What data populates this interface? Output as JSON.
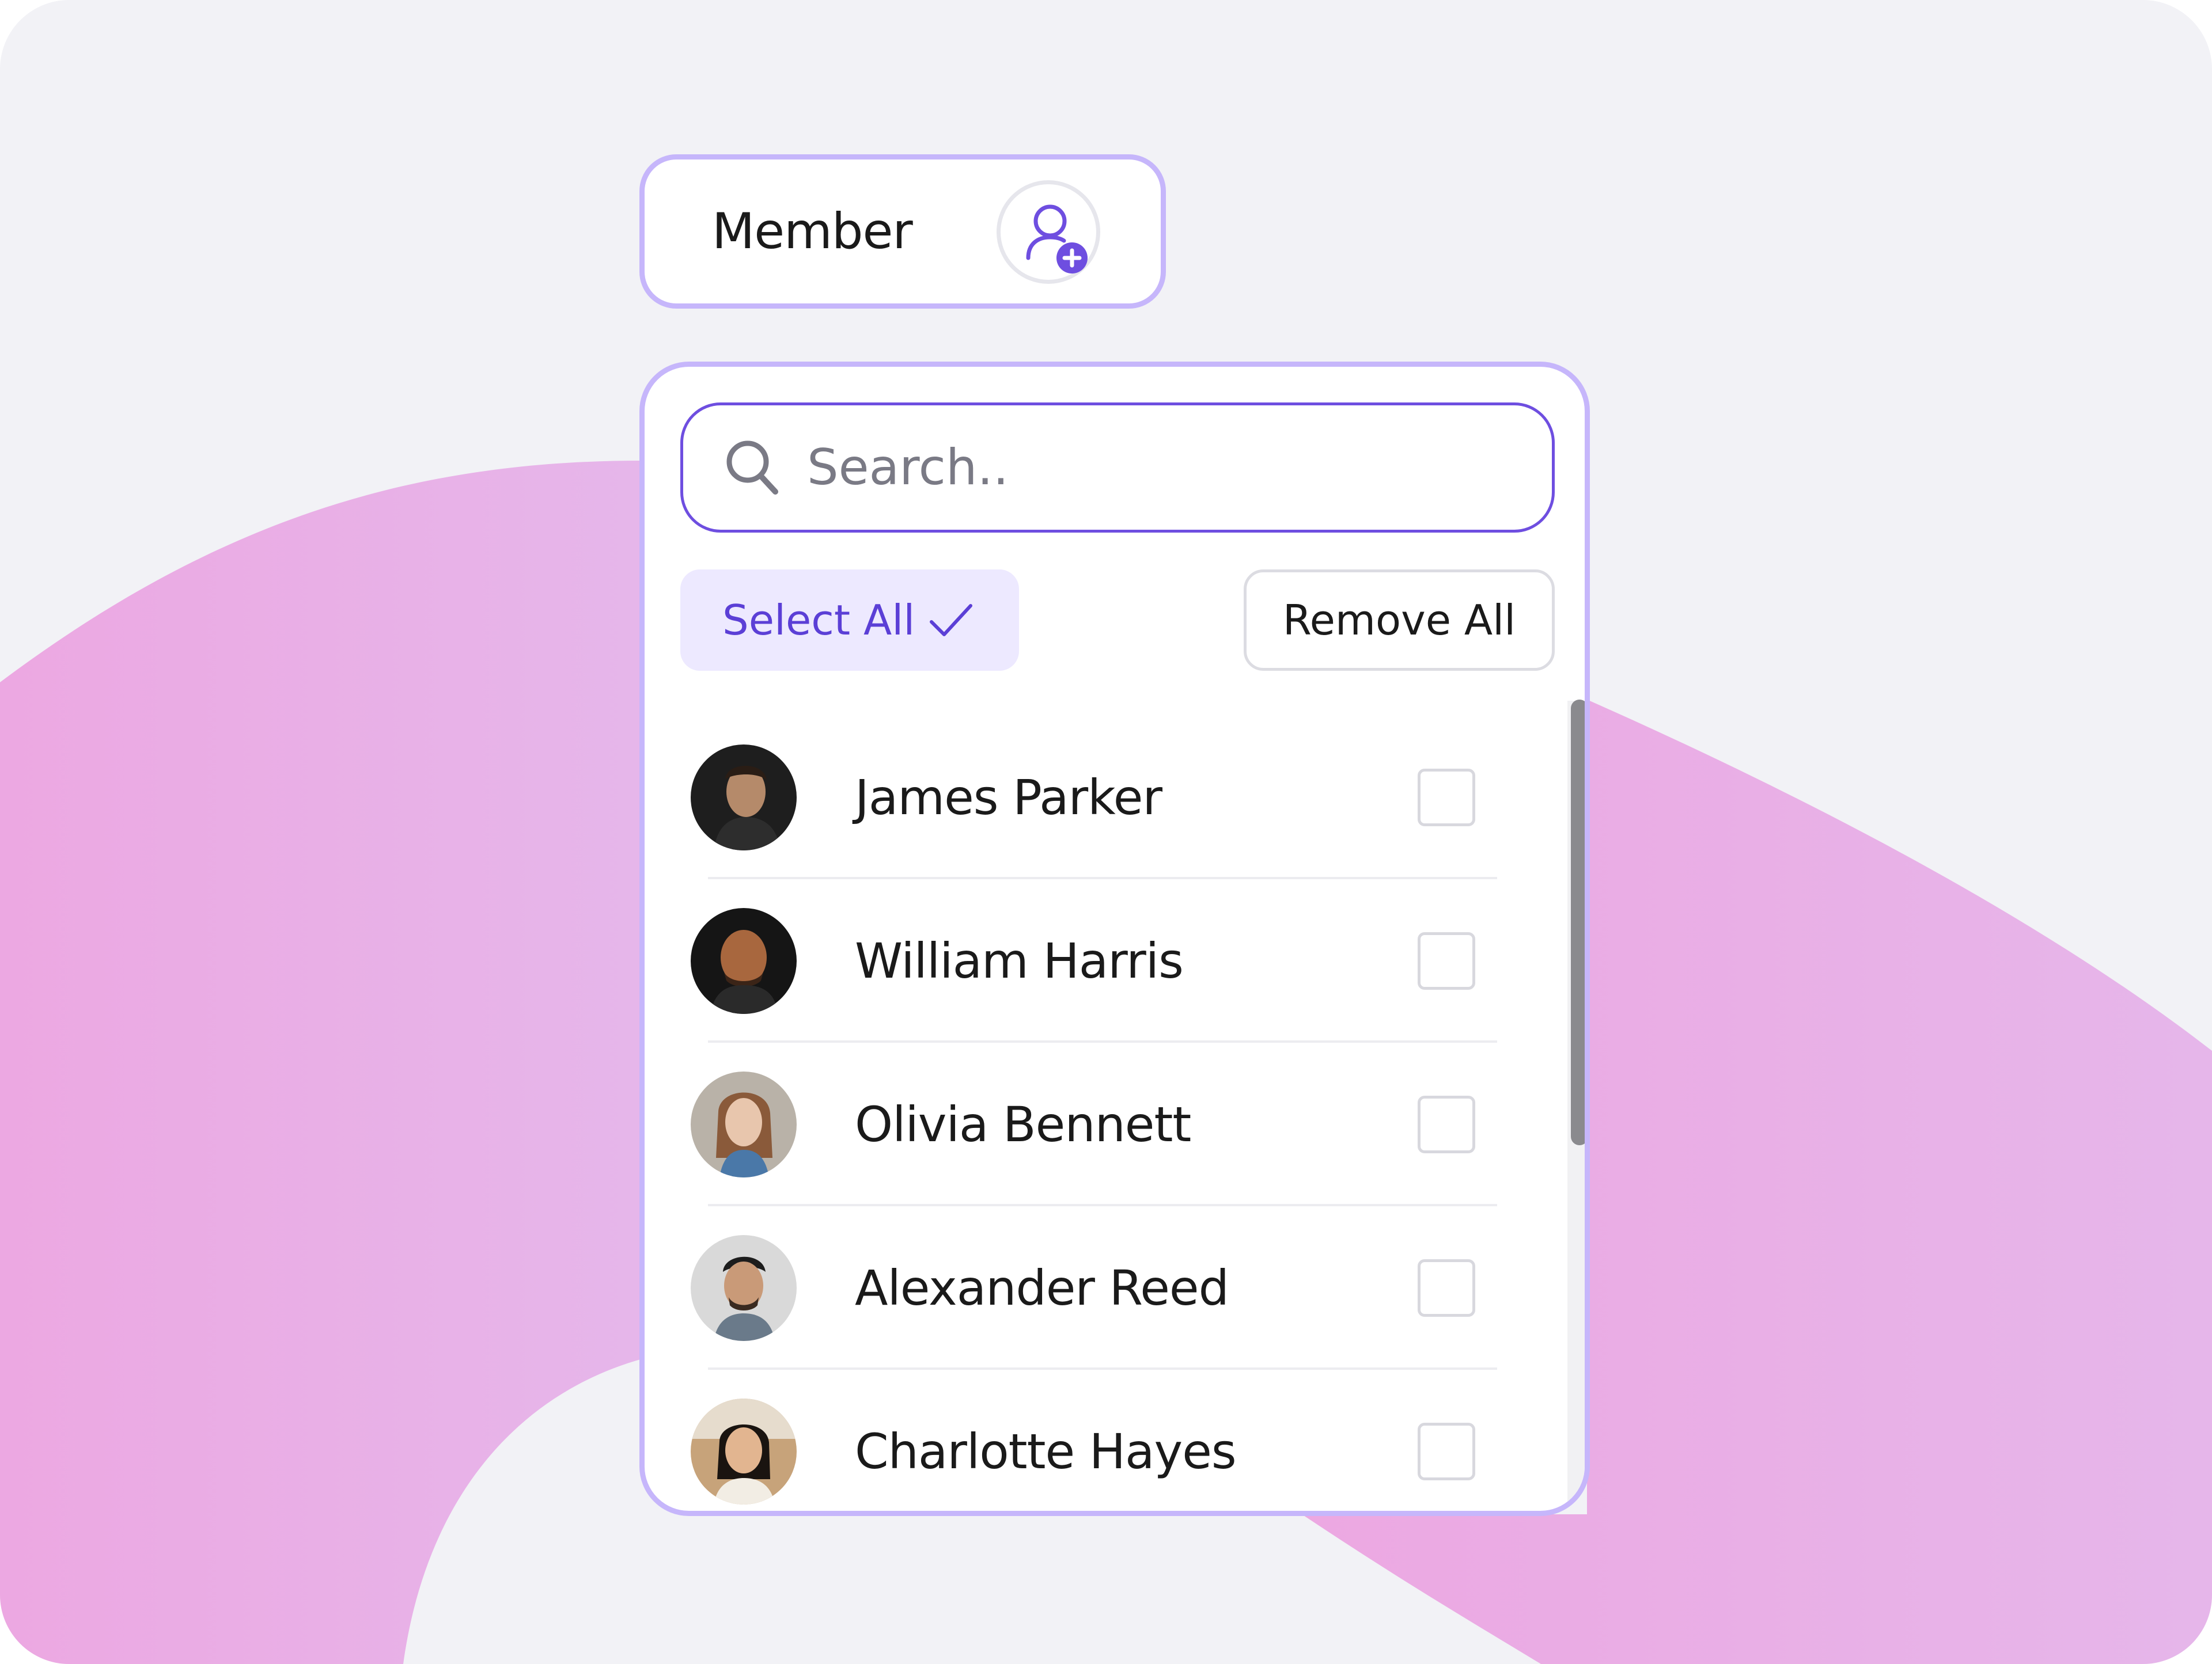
{
  "member_button": {
    "label": "Member",
    "icon": "user-add-icon"
  },
  "search": {
    "placeholder": "Search..",
    "value": "",
    "icon": "search-icon"
  },
  "actions": {
    "select_all_label": "Select All",
    "select_all_icon": "check-icon",
    "remove_all_label": "Remove All"
  },
  "members": [
    {
      "name": "James Parker",
      "checked": false
    },
    {
      "name": "William Harris",
      "checked": false
    },
    {
      "name": "Olivia Bennett",
      "checked": false
    },
    {
      "name": "Alexander Reed",
      "checked": false
    },
    {
      "name": "Charlotte Hayes",
      "checked": false
    }
  ],
  "colors": {
    "accent": "#6e4ee0",
    "accent_light": "#ede9ff",
    "panel_border": "#c6b6fb",
    "background": "#f2f2f6",
    "blob": "#eaaee4"
  }
}
